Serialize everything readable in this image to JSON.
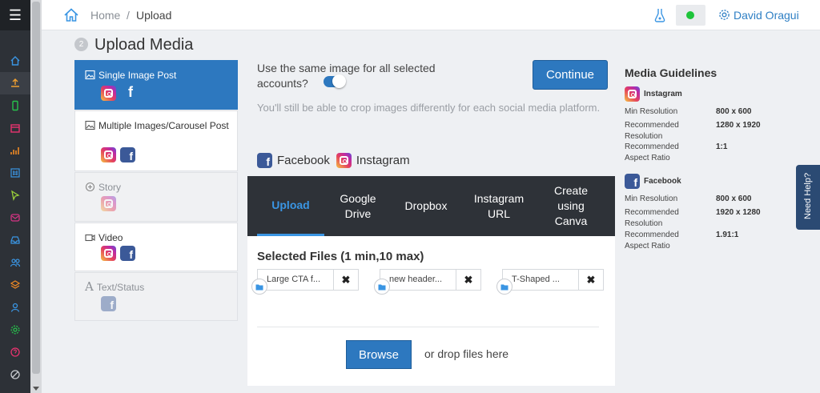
{
  "breadcrumb": {
    "home": "Home",
    "separator": "/",
    "current": "Upload"
  },
  "user": {
    "name": "David Oragui",
    "status_color": "#1ec43a"
  },
  "page": {
    "step": "2",
    "title": "Upload Media"
  },
  "post_types": [
    {
      "label": "Single Image Post",
      "icon": "image-icon",
      "networks": [
        "instagram",
        "facebook"
      ],
      "state": "selected"
    },
    {
      "label": "Multiple Images/Carousel Post",
      "icon": "images-icon",
      "networks": [
        "instagram",
        "facebook"
      ],
      "state": "normal"
    },
    {
      "label": "Story",
      "icon": "plus-circle-icon",
      "networks": [
        "instagram"
      ],
      "state": "disabled"
    },
    {
      "label": "Video",
      "icon": "video-icon",
      "networks": [
        "instagram",
        "facebook"
      ],
      "state": "normal"
    },
    {
      "label": "Text/Status",
      "icon": "text-icon",
      "networks": [
        "facebook"
      ],
      "state": "disabled"
    }
  ],
  "options": {
    "same_image_text": "Use the same image for all selected accounts?",
    "toggle_on": true,
    "continue_label": "Continue",
    "crop_note": "You'll still be able to crop images differently for each social media platform."
  },
  "networks": {
    "facebook": "Facebook",
    "instagram": "Instagram"
  },
  "upload": {
    "tabs": [
      "Upload",
      "Google Drive",
      "Dropbox",
      "Instagram URL",
      "Create using Canva"
    ],
    "active_tab": "Upload",
    "selected_files_label": "Selected Files (1 min,10 max)",
    "files": [
      "Large CTA f...",
      "new header...",
      "T-Shaped ..."
    ],
    "browse_label": "Browse",
    "drop_text": "or drop files here"
  },
  "guidelines": {
    "title": "Media Guidelines",
    "instagram": {
      "name": "Instagram",
      "min_label": "Min Resolution",
      "min_value": "800 x 600",
      "rec_label": "Recommended Resolution",
      "rec_value": "1280 x 1920",
      "ar_label": "Recommended Aspect Ratio",
      "ar_value": "1:1"
    },
    "facebook": {
      "name": "Facebook",
      "min_label": "Min Resolution",
      "min_value": "800 x 600",
      "rec_label": "Recommended Resolution",
      "rec_value": "1920 x 1280",
      "ar_label": "Recommended Aspect Ratio",
      "ar_value": "1.91:1"
    }
  },
  "help_label": "Need Help?",
  "colors": {
    "accent": "#2d78bf",
    "tabbar": "#2e3238",
    "instagram": "#e4405f",
    "facebook": "#3b5998"
  }
}
